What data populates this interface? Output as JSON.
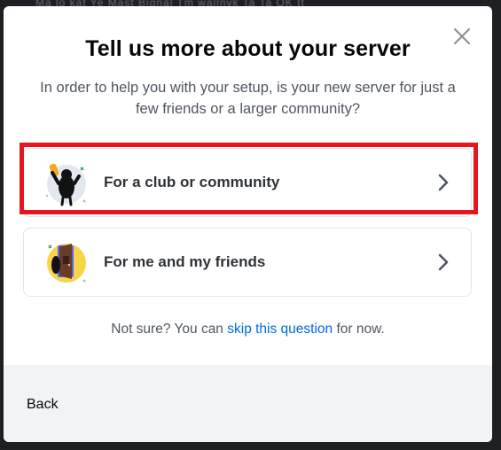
{
  "background": {
    "blurred_text": "Ma lo kat Ye Mast Bignal Tm wallnyk Ta Ta OK It"
  },
  "modal": {
    "title": "Tell us more about your server",
    "subtitle": "In order to help you with your setup, is your new server for just a few friends or a larger community?",
    "options": [
      {
        "label": "For a club or community",
        "icon": "club-community-illustration-icon",
        "highlighted": true
      },
      {
        "label": "For me and my friends",
        "icon": "friends-door-illustration-icon",
        "highlighted": false
      }
    ],
    "footnote": {
      "prefix": "Not sure? You can ",
      "link": "skip this question",
      "suffix": " for now."
    },
    "back_label": "Back"
  },
  "colors": {
    "highlight": "#e8141f",
    "link": "#0068e0",
    "footer_bg": "#f2f3f5"
  }
}
